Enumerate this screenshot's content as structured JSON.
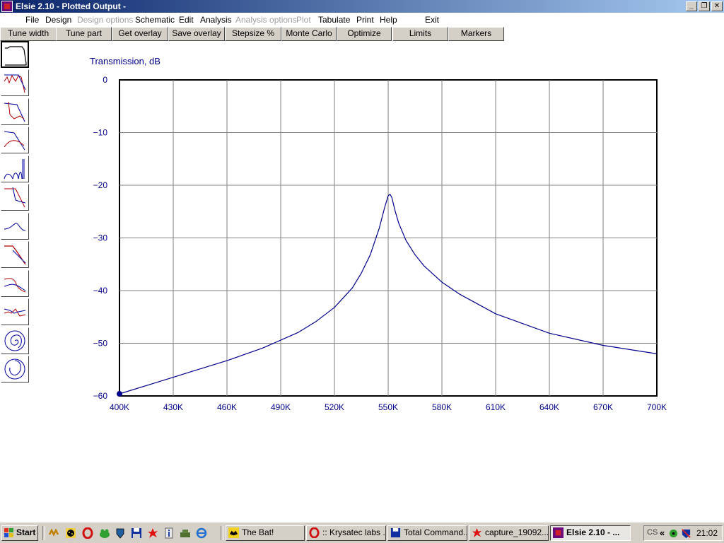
{
  "window": {
    "title": "Elsie 2.10 - Plotted Output -"
  },
  "menu": [
    {
      "label": "File",
      "enabled": true
    },
    {
      "label": "Design",
      "enabled": true
    },
    {
      "label": "Design options",
      "enabled": false
    },
    {
      "label": "Schematic",
      "enabled": true
    },
    {
      "label": "Edit",
      "enabled": true
    },
    {
      "label": "Analysis",
      "enabled": true
    },
    {
      "label": "Analysis options",
      "enabled": false
    },
    {
      "label": "Plot",
      "enabled": false
    },
    {
      "label": "Tabulate",
      "enabled": true
    },
    {
      "label": "Print",
      "enabled": true
    },
    {
      "label": "Help",
      "enabled": true
    },
    {
      "label": "Exit",
      "enabled": true
    }
  ],
  "toolbar": [
    "Tune width",
    "Tune part",
    "Get overlay",
    "Save overlay",
    "Stepsize %",
    "Monte Carlo",
    "Optimize",
    "Limits",
    "Markers"
  ],
  "sidebar_icons": [
    "plot-type-1-icon",
    "plot-type-2-icon",
    "plot-type-3-icon",
    "plot-type-4-icon",
    "plot-type-5-icon",
    "plot-type-6-icon",
    "plot-type-7-icon",
    "plot-type-8-icon",
    "plot-type-9-icon",
    "plot-type-10-icon",
    "smith-chart-icon",
    "polar-chart-icon"
  ],
  "chart_data": {
    "type": "line",
    "title": "Transmission, dB",
    "xlabel": "",
    "ylabel": "Transmission, dB",
    "x_ticks": [
      "400K",
      "430K",
      "460K",
      "490K",
      "520K",
      "550K",
      "580K",
      "610K",
      "640K",
      "670K",
      "700K"
    ],
    "y_ticks": [
      "0",
      "−10",
      "−20",
      "−30",
      "−40",
      "−50",
      "−60"
    ],
    "xlim": [
      400000,
      700000
    ],
    "ylim": [
      -60,
      0
    ],
    "grid": true,
    "line_color": "#00008b",
    "series": [
      {
        "x": [
          400000,
          420000,
          440000,
          460000,
          480000,
          500000,
          510000,
          520000,
          530000,
          535000,
          540000,
          545000,
          548000,
          550000,
          551000,
          552000,
          554000,
          556000,
          560000,
          565000,
          570000,
          580000,
          590000,
          610000,
          640000,
          670000,
          700000
        ],
        "y": [
          -59.6,
          -57.5,
          -55.4,
          -53.3,
          -50.9,
          -47.9,
          -45.8,
          -43.2,
          -39.5,
          -36.7,
          -33.2,
          -28.2,
          -24.3,
          -22.0,
          -21.7,
          -22.3,
          -25.0,
          -27.3,
          -30.5,
          -33.2,
          -35.3,
          -38.4,
          -40.7,
          -44.4,
          -48.1,
          -50.4,
          -52.0
        ]
      }
    ]
  },
  "taskbar": {
    "start_label": "Start",
    "quicklaunch": [
      "winamp-icon",
      "ladybug-icon",
      "opera-icon",
      "frog-icon",
      "shield-icon",
      "floppy-icon",
      "splash-icon",
      "info-icon",
      "tank-icon",
      "ie-icon"
    ],
    "tasks": [
      {
        "label": "The Bat!",
        "icon": "thebat-icon"
      },
      {
        "label": ":: Krysatec labs ...",
        "icon": "opera-icon"
      },
      {
        "label": "Total Command...",
        "icon": "floppy-icon"
      },
      {
        "label": "capture_19092...",
        "icon": "splash-icon"
      },
      {
        "label": "Elsie 2.10 - ...",
        "icon": "elsie-icon",
        "active": true
      }
    ],
    "tray_label": "CS",
    "clock": "21:02"
  },
  "colors": {
    "titlebar_start": "#0a246a",
    "titlebar_end": "#a6caf0",
    "plot_line": "#00008b",
    "label": "#00008b",
    "face": "#d4d0c8"
  }
}
